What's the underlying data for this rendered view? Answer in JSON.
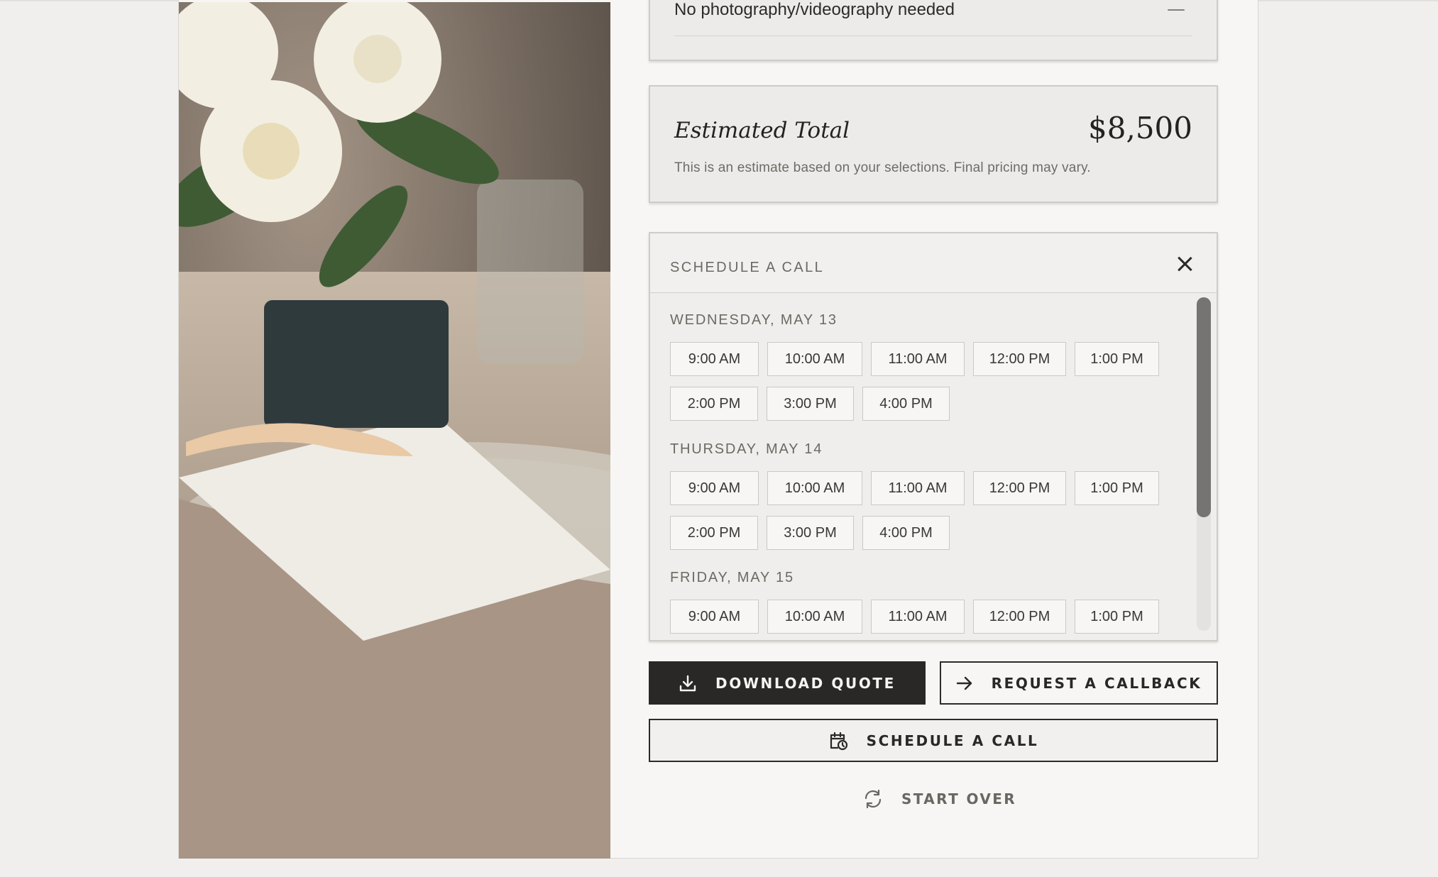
{
  "photography": {
    "label": "No photography/videography needed",
    "collapse_symbol": "—"
  },
  "estimate": {
    "label": "Estimated Total",
    "value": "$8,500",
    "note": "This is an estimate based on your selections. Final pricing may vary."
  },
  "scheduler": {
    "title": "SCHEDULE A CALL",
    "close_icon": "close-icon",
    "days": [
      {
        "label": "WEDNESDAY, MAY 13",
        "slots": [
          "9:00 AM",
          "10:00 AM",
          "11:00 AM",
          "12:00 PM",
          "1:00 PM",
          "2:00 PM",
          "3:00 PM",
          "4:00 PM"
        ]
      },
      {
        "label": "THURSDAY, MAY 14",
        "slots": [
          "9:00 AM",
          "10:00 AM",
          "11:00 AM",
          "12:00 PM",
          "1:00 PM",
          "2:00 PM",
          "3:00 PM",
          "4:00 PM"
        ]
      },
      {
        "label": "FRIDAY, MAY 15",
        "slots": [
          "9:00 AM",
          "10:00 AM",
          "11:00 AM",
          "12:00 PM",
          "1:00 PM"
        ]
      }
    ]
  },
  "actions": {
    "download": {
      "label": "DOWNLOAD QUOTE",
      "icon": "download-icon"
    },
    "callback": {
      "label": "REQUEST A CALLBACK",
      "icon": "arrow-right-icon"
    },
    "schedule": {
      "label": "SCHEDULE A CALL",
      "icon": "calendar-clock-icon"
    },
    "start_over": {
      "label": "START OVER",
      "icon": "refresh-icon"
    }
  },
  "colors": {
    "dark": "#2a2826",
    "panel": "#ecebe9",
    "border": "#cfccc8",
    "muted": "#6d6964"
  }
}
